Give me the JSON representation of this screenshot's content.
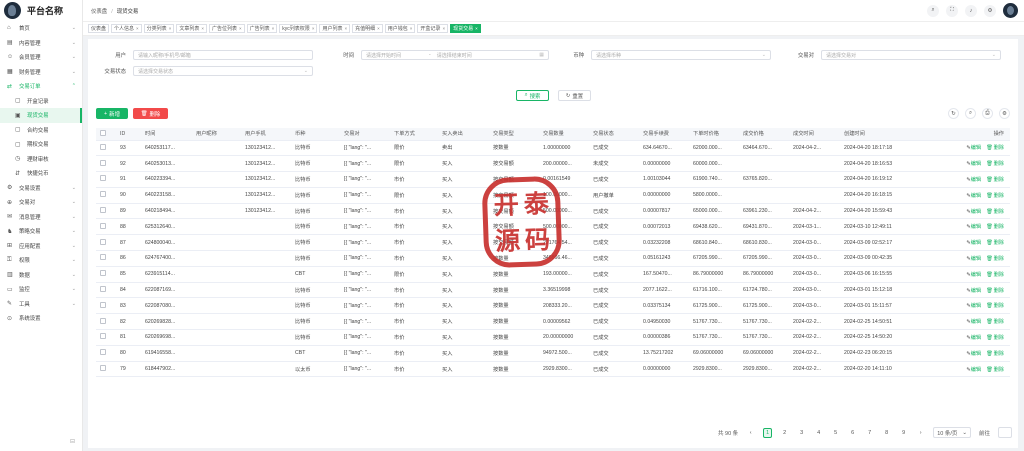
{
  "app": {
    "logo_text": "平台名称"
  },
  "sidebar": {
    "items": [
      {
        "icon": "⌂",
        "icon_name": "home-icon",
        "label": "首页",
        "arrow": "⌄"
      },
      {
        "icon": "▤",
        "icon_name": "document-icon",
        "label": "内容管理",
        "arrow": "⌄"
      },
      {
        "icon": "☺",
        "icon_name": "user-icon",
        "label": "会员管理",
        "arrow": "⌄"
      },
      {
        "icon": "▦",
        "icon_name": "finance-icon",
        "label": "财务管理",
        "arrow": "⌄"
      },
      {
        "icon": "⇄",
        "icon_name": "order-icon",
        "label": "交易订单",
        "arrow": "⌃",
        "active": true
      },
      {
        "icon": "▢",
        "icon_name": "open-record-icon",
        "label": "开盒记录",
        "sub": true
      },
      {
        "icon": "▣",
        "icon_name": "spot-trade-icon",
        "label": "现货交易",
        "sub": true,
        "selected": true
      },
      {
        "icon": "▢",
        "icon_name": "contract-icon",
        "label": "合约交易",
        "sub": true
      },
      {
        "icon": "▢",
        "icon_name": "option-icon",
        "label": "期权交易",
        "sub": true
      },
      {
        "icon": "◷",
        "icon_name": "finance-review-icon",
        "label": "理财审核",
        "sub": true
      },
      {
        "icon": "⇵",
        "icon_name": "flash-swap-icon",
        "label": "快捷兑币",
        "sub": true
      },
      {
        "icon": "⚙",
        "icon_name": "settings-icon",
        "label": "交易设置",
        "arrow": "⌄"
      },
      {
        "icon": "⊕",
        "icon_name": "pair-icon",
        "label": "交易对",
        "arrow": "⌄"
      },
      {
        "icon": "✉",
        "icon_name": "message-icon",
        "label": "消息管理",
        "arrow": "⌄"
      },
      {
        "icon": "♞",
        "icon_name": "strategy-icon",
        "label": "策略交易",
        "arrow": "⌄"
      },
      {
        "icon": "⊞",
        "icon_name": "app-icon",
        "label": "应用配置",
        "arrow": "⌄"
      },
      {
        "icon": "⚿",
        "icon_name": "permission-icon",
        "label": "权限",
        "arrow": "⌄"
      },
      {
        "icon": "▥",
        "icon_name": "data-icon",
        "label": "数据",
        "arrow": "⌄"
      },
      {
        "icon": "▭",
        "icon_name": "monitor-icon",
        "label": "监控",
        "arrow": "⌄"
      },
      {
        "icon": "✎",
        "icon_name": "tool-icon",
        "label": "工具",
        "arrow": "⌄"
      },
      {
        "icon": "⊙",
        "icon_name": "system-icon",
        "label": "系统设置"
      }
    ]
  },
  "header": {
    "breadcrumb": [
      "仪表盘",
      "现货交易"
    ],
    "icons": [
      "search-icon",
      "fullscreen-icon",
      "bell-icon",
      "gear-icon"
    ]
  },
  "tags": [
    {
      "label": "仪表盘",
      "closable": false
    },
    {
      "label": "个人信息",
      "closable": true
    },
    {
      "label": "分类列表",
      "closable": true
    },
    {
      "label": "文章列表",
      "closable": true
    },
    {
      "label": "广告位列表",
      "closable": true
    },
    {
      "label": "广告列表",
      "closable": true
    },
    {
      "label": "kyc列表权限",
      "closable": true
    },
    {
      "label": "用户列表",
      "closable": true
    },
    {
      "label": "充值明细",
      "closable": true
    },
    {
      "label": "用户钱包",
      "closable": true
    },
    {
      "label": "开盒记录",
      "closable": true
    },
    {
      "label": "现货交易",
      "closable": true,
      "active": true
    }
  ],
  "filters": {
    "user_label": "用户",
    "user_placeholder": "请输入昵称/手机号/邮箱",
    "time_label": "时间",
    "start_placeholder": "请选择开始时间",
    "end_placeholder": "请选择结束时间",
    "coin_label": "币种",
    "coin_placeholder": "请选择币种",
    "pair_label": "交易对",
    "pair_placeholder": "请选择交易对",
    "status_label": "交易状态",
    "status_placeholder": "请选择交易状态",
    "search_label": "搜索",
    "reset_label": "重置"
  },
  "toolbar": {
    "add_label": "新增",
    "delete_label": "删除"
  },
  "table": {
    "columns": [
      "ID",
      "时间",
      "用户昵称",
      "用户手机",
      "币种",
      "交易对",
      "下单方式",
      "买入卖出",
      "交易类型",
      "交易数量",
      "交易状态",
      "交易手续费",
      "下单时价格",
      "成交价格",
      "成交时间",
      "创建时间",
      "操作"
    ],
    "edit_label": "编辑",
    "delete_label": "删除",
    "rows": [
      [
        "93",
        "640253117...",
        "",
        "130123412...",
        "比特币",
        "[{ \"lang\": \"...",
        "限价",
        "卖出",
        "按数量",
        "1.00000000",
        "已成交",
        "634.64670...",
        "62000.000...",
        "63464.670...",
        "2024-04-2...",
        "2024-04-20 18:17:18"
      ],
      [
        "92",
        "640253013...",
        "",
        "130123412...",
        "比特币",
        "[{ \"lang\": \"...",
        "限价",
        "买入",
        "按交易额",
        "200.00000...",
        "未成交",
        "0.00000000",
        "60000.000...",
        "",
        "",
        "2024-04-20 18:16:53"
      ],
      [
        "91",
        "640223394...",
        "",
        "130123412...",
        "比特币",
        "[{ \"lang\": \"...",
        "市价",
        "买入",
        "按交易额",
        "0.00161549",
        "已成交",
        "1.00103044",
        "61900.740...",
        "63765.820...",
        "",
        "2024-04-20 16:19:12"
      ],
      [
        "90",
        "640223158...",
        "",
        "130123412...",
        "比特币",
        "[{ \"lang\": \"...",
        "限价",
        "买入",
        "按交易额",
        "100.00000...",
        "用户撤单",
        "0.00000000",
        "5800.0000...",
        "",
        "",
        "2024-04-20 16:18:15"
      ],
      [
        "89",
        "640218494...",
        "",
        "130123412...",
        "比特币",
        "[{ \"lang\": \"...",
        "市价",
        "买入",
        "按交易额",
        "500.00000...",
        "已成交",
        "0.00007817",
        "65000.000...",
        "63961.230...",
        "2024-04-2...",
        "2024-04-20 15:59:43"
      ],
      [
        "88",
        "625312640...",
        "",
        "",
        "比特币",
        "[{ \"lang\": \"...",
        "市价",
        "买入",
        "按交易额",
        "500.00000...",
        "已成交",
        "0.00072013",
        "69438.620...",
        "69431.870...",
        "2024-03-1...",
        "2024-03-10 12:49:11"
      ],
      [
        "87",
        "624800040...",
        "",
        "",
        "比特币",
        "[{ \"lang\": \"...",
        "市价",
        "买入",
        "按交易额",
        "221764.54...",
        "已成交",
        "0.03232208",
        "68610.840...",
        "68610.830...",
        "2024-03-0...",
        "2024-03-09 02:52:17"
      ],
      [
        "86",
        "624767400...",
        "",
        "",
        "比特币",
        "[{ \"lang\": \"...",
        "市价",
        "买入",
        "按数量",
        "346866.46...",
        "已成交",
        "0.05161243",
        "67205.990...",
        "67205.990...",
        "2024-03-0...",
        "2024-03-09 00:42:35"
      ],
      [
        "85",
        "623915114...",
        "",
        "",
        "CBT",
        "[{ \"lang\": \"...",
        "限价",
        "买入",
        "按数量",
        "193.00000...",
        "已成交",
        "167.50470...",
        "86.79000000",
        "86.79000000",
        "2024-03-0...",
        "2024-03-06 16:15:55"
      ],
      [
        "84",
        "622087169...",
        "",
        "",
        "比特币",
        "[{ \"lang\": \"...",
        "市价",
        "买入",
        "按数量",
        "3.36519998",
        "已成交",
        "2077.1622...",
        "61716.100...",
        "61724.780...",
        "2024-03-0...",
        "2024-03-01 15:12:18"
      ],
      [
        "83",
        "622087080...",
        "",
        "",
        "比特币",
        "[{ \"lang\": \"...",
        "市价",
        "买入",
        "按数量",
        "208333.20...",
        "已成交",
        "0.03375134",
        "61725.900...",
        "61725.900...",
        "2024-03-0...",
        "2024-03-01 15:11:57"
      ],
      [
        "82",
        "620269828...",
        "",
        "",
        "比特币",
        "[{ \"lang\": \"...",
        "市价",
        "买入",
        "按数量",
        "0.00009562",
        "已成交",
        "0.04950030",
        "51767.730...",
        "51767.730...",
        "2024-02-2...",
        "2024-02-25 14:50:51"
      ],
      [
        "81",
        "620269698...",
        "",
        "",
        "比特币",
        "[{ \"lang\": \"...",
        "市价",
        "买入",
        "按数量",
        "20.00000000",
        "已成交",
        "0.00000386",
        "51767.730...",
        "51767.730...",
        "2024-02-2...",
        "2024-02-25 14:50:20"
      ],
      [
        "80",
        "619416558...",
        "",
        "",
        "CBT",
        "[{ \"lang\": \"...",
        "市价",
        "买入",
        "按数量",
        "94972.500...",
        "已成交",
        "13.75217202",
        "69.06000000",
        "69.06000000",
        "2024-02-2...",
        "2024-02-23 06:20:15"
      ],
      [
        "79",
        "618447902...",
        "",
        "",
        "以太币",
        "[{ \"lang\": \"...",
        "市价",
        "买入",
        "按数量",
        "2929.8300...",
        "已成交",
        "0.00000000",
        "2929.8300...",
        "2929.8300...",
        "2024-02-2...",
        "2024-02-20 14:11:10"
      ]
    ]
  },
  "pagination": {
    "total_text": "共 90 条",
    "prev": "‹",
    "next": "›",
    "pages": [
      "1",
      "2",
      "3",
      "4",
      "5",
      "6",
      "7",
      "8",
      "9"
    ],
    "current": "1",
    "size_text": "10 条/页",
    "jump_label": "前往"
  },
  "watermark": {
    "text": [
      "开",
      "泰",
      "源",
      "码"
    ],
    "color": "#c8312f"
  },
  "colors": {
    "accent": "#18b566",
    "danger": "#f24a4a"
  }
}
